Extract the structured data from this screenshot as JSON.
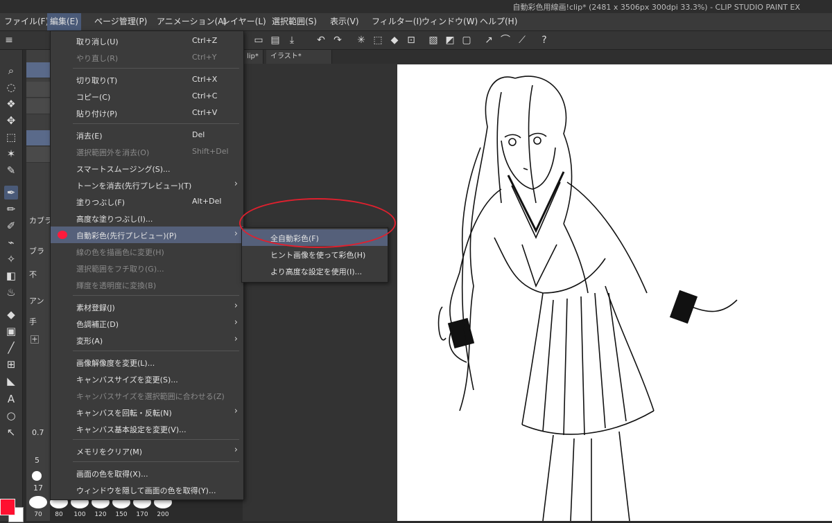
{
  "window": {
    "title": "自動彩色用線画!clip* (2481 x 3506px 300dpi 33.3%)  - CLIP STUDIO PAINT EX"
  },
  "menubar": [
    "ファイル(F)",
    "編集(E)",
    "ページ管理(P)",
    "アニメーション(A)",
    "レイヤー(L)",
    "選択範囲(S)",
    "表示(V)",
    "フィルター(I)",
    "ウィンドウ(W)",
    "ヘルプ(H)"
  ],
  "tabs": [
    "lip*",
    "イラスト*"
  ],
  "edit_menu": {
    "items": [
      {
        "label": "取り消し(U)",
        "shortcut": "Ctrl+Z",
        "disabled": false
      },
      {
        "label": "やり直し(R)",
        "shortcut": "Ctrl+Y",
        "disabled": true
      },
      {
        "label": "切り取り(T)",
        "shortcut": "Ctrl+X",
        "disabled": false
      },
      {
        "label": "コピー(C)",
        "shortcut": "Ctrl+C",
        "disabled": false
      },
      {
        "label": "貼り付け(P)",
        "shortcut": "Ctrl+V",
        "disabled": false
      },
      {
        "label": "消去(E)",
        "shortcut": "Del",
        "disabled": false
      },
      {
        "label": "選択範囲外を消去(O)",
        "shortcut": "Shift+Del",
        "disabled": true
      },
      {
        "label": "スマートスムージング(S)...",
        "shortcut": "",
        "disabled": false
      },
      {
        "label": "トーンを消去(先行プレビュー)(T)",
        "shortcut": "",
        "disabled": false
      },
      {
        "label": "塗りつぶし(F)",
        "shortcut": "Alt+Del",
        "disabled": false
      },
      {
        "label": "高度な塗りつぶし(I)...",
        "shortcut": "",
        "disabled": false
      },
      {
        "label": "自動彩色(先行プレビュー)(P)",
        "shortcut": "",
        "disabled": false
      },
      {
        "label": "線の色を描画色に変更(H)",
        "shortcut": "",
        "disabled": true
      },
      {
        "label": "選択範囲をフチ取り(G)...",
        "shortcut": "",
        "disabled": true
      },
      {
        "label": "輝度を透明度に変換(B)",
        "shortcut": "",
        "disabled": true
      },
      {
        "label": "素材登録(J)",
        "shortcut": "",
        "disabled": false
      },
      {
        "label": "色調補正(D)",
        "shortcut": "",
        "disabled": false
      },
      {
        "label": "変形(A)",
        "shortcut": "",
        "disabled": false
      },
      {
        "label": "画像解像度を変更(L)...",
        "shortcut": "",
        "disabled": false
      },
      {
        "label": "キャンバスサイズを変更(S)...",
        "shortcut": "",
        "disabled": false
      },
      {
        "label": "キャンバスサイズを選択範囲に合わせる(Z)",
        "shortcut": "",
        "disabled": true
      },
      {
        "label": "キャンバスを回転・反転(N)",
        "shortcut": "",
        "disabled": false
      },
      {
        "label": "キャンバス基本設定を変更(V)...",
        "shortcut": "",
        "disabled": false
      },
      {
        "label": "メモリをクリア(M)",
        "shortcut": "",
        "disabled": false
      },
      {
        "label": "画面の色を取得(X)...",
        "shortcut": "",
        "disabled": false
      },
      {
        "label": "ウィンドウを隠して画面の色を取得(Y)...",
        "shortcut": "",
        "disabled": false
      }
    ]
  },
  "auto_color_submenu": {
    "items": [
      "全自動彩色(F)",
      "ヒント画像を使って彩色(H)",
      "より高度な設定を使用(I)..."
    ]
  },
  "tool_panel": {
    "labels": [
      "カブラ",
      "ブラ",
      "不",
      "アン",
      "手"
    ]
  },
  "brush_size": {
    "left_values": [
      "0.7",
      "5",
      "17"
    ],
    "values": [
      "70",
      "80",
      "100",
      "120",
      "150",
      "170",
      "200"
    ]
  },
  "colors": {
    "main": "#ff1030",
    "sub": "#ffffff",
    "highlight": "#55607a",
    "annotation": "#e0202e"
  }
}
